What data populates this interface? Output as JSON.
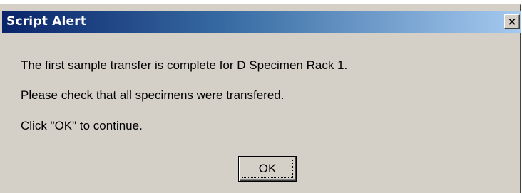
{
  "window": {
    "title": "Script Alert",
    "close_glyph": "×",
    "close_icon": "close-icon"
  },
  "message": {
    "line1": "The first sample transfer is complete for D Specimen Rack 1.",
    "line2": "Please check that all specimens were transfered.",
    "line3": "Click \"OK\" to continue."
  },
  "buttons": {
    "ok_label": "OK"
  },
  "colors": {
    "titlebar_start": "#0a246a",
    "titlebar_end": "#a6caf0",
    "dialog_face": "#d4d0c8"
  }
}
